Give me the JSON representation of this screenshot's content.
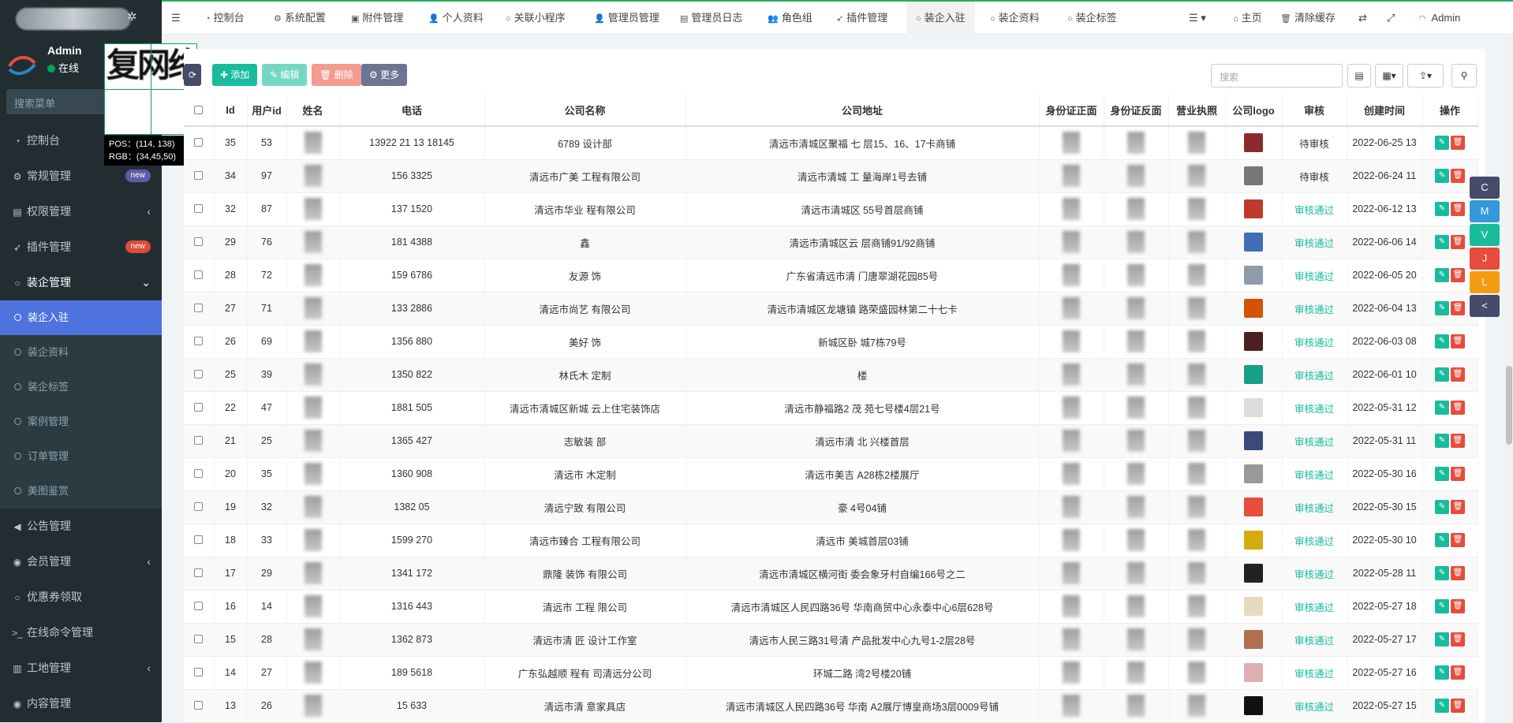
{
  "sidebar": {
    "user_name": "Admin",
    "user_status": "在线",
    "search_placeholder": "搜索菜单",
    "menu": [
      {
        "label": "控制台",
        "icon": "dashboard-icon"
      },
      {
        "label": "常规管理",
        "icon": "cogs-icon",
        "badge": "new"
      },
      {
        "label": "权限管理",
        "icon": "group-icon",
        "chevron": "‹"
      },
      {
        "label": "插件管理",
        "icon": "rocket-icon",
        "badge": "new"
      },
      {
        "label": "装企管理",
        "icon": "circle-icon",
        "chevron": "⌄"
      }
    ],
    "submenu": [
      {
        "label": "装企入驻"
      },
      {
        "label": "装企资料"
      },
      {
        "label": "装企标签"
      },
      {
        "label": "案例管理"
      },
      {
        "label": "订单管理"
      },
      {
        "label": "美图鉴赏"
      }
    ],
    "menu2": [
      {
        "label": "公告管理",
        "icon": "bullhorn-icon"
      },
      {
        "label": "会员管理",
        "icon": "user-circle-icon",
        "chevron": "‹"
      },
      {
        "label": "优惠券领取",
        "icon": "circle-icon"
      },
      {
        "label": "在线命令管理",
        "icon": "terminal-icon"
      },
      {
        "label": "工地管理",
        "icon": "bank-icon",
        "chevron": "‹"
      },
      {
        "label": "内容管理",
        "icon": "user-circle-icon"
      }
    ]
  },
  "zoom": {
    "magnified_text": "复网络",
    "pos": "POS：(114, 138)",
    "rgb": "RGB：(34,45,50)"
  },
  "topnav": {
    "tabs": [
      {
        "label": "控制台",
        "icon": "dashboard-icon"
      },
      {
        "label": "系统配置",
        "icon": "cog-icon"
      },
      {
        "label": "附件管理",
        "icon": "image-icon"
      },
      {
        "label": "个人资料",
        "icon": "user-icon"
      },
      {
        "label": "关联小程序",
        "icon": "circle-icon"
      },
      {
        "label": "管理员管理",
        "icon": "user-icon"
      },
      {
        "label": "管理员日志",
        "icon": "list-icon"
      },
      {
        "label": "角色组",
        "icon": "group-icon"
      },
      {
        "label": "插件管理",
        "icon": "rocket-icon"
      },
      {
        "label": "装企入驻",
        "icon": "circle-icon"
      },
      {
        "label": "装企资料",
        "icon": "circle-icon"
      },
      {
        "label": "装企标签",
        "icon": "circle-icon"
      }
    ],
    "home": "主页",
    "clear_cache": "清除缓存",
    "admin": "Admin"
  },
  "toolbar": {
    "add": "添加",
    "edit": "编辑",
    "delete": "删除",
    "more": "更多",
    "search_placeholder": "搜索"
  },
  "table": {
    "headers": [
      "",
      "Id",
      "用户id",
      "姓名",
      "电话",
      "公司名称",
      "公司地址",
      "身份证正面",
      "身份证反面",
      "营业执照",
      "公司logo",
      "审核",
      "创建时间",
      "操作"
    ],
    "rows": [
      {
        "id": "35",
        "uid": "53",
        "phone": "13922 21 13 18145",
        "company": "6789 设计部",
        "address": "清远市清城区聚福 七 层15、16、17卡商铺",
        "status": "待审核",
        "created": "2022-06-25 13",
        "logo_color": "#8b2b2b"
      },
      {
        "id": "34",
        "uid": "97",
        "phone": "156 3325",
        "company": "清远市广美 工程有限公司",
        "address": "清远市清城 工 量海岸1号去铺",
        "status": "待审核",
        "created": "2022-06-24 11",
        "logo_color": "#777777"
      },
      {
        "id": "32",
        "uid": "87",
        "phone": "137 1520",
        "company": "清远市华业 程有限公司",
        "address": "清远市清城区 55号首层商铺",
        "status": "审核通过",
        "created": "2022-06-12 13",
        "logo_color": "#c0392b"
      },
      {
        "id": "29",
        "uid": "76",
        "phone": "181 4388",
        "company": "鑫",
        "address": "清远市清城区云 层商铺91/92商铺",
        "status": "审核通过",
        "created": "2022-06-06 14",
        "logo_color": "#3f6fb5"
      },
      {
        "id": "28",
        "uid": "72",
        "phone": "159 6786",
        "company": "友源 饰",
        "address": "广东省清远市清 门唐翠湖花园85号",
        "status": "审核通过",
        "created": "2022-06-05 20",
        "logo_color": "#8e9bab"
      },
      {
        "id": "27",
        "uid": "71",
        "phone": "133 2886",
        "company": "清远市尚艺 有限公司",
        "address": "清远市清城区龙塘镇 路荣盛园林第二十七卡",
        "status": "审核通过",
        "created": "2022-06-04 13",
        "logo_color": "#d35400"
      },
      {
        "id": "26",
        "uid": "69",
        "phone": "1356 880",
        "company": "美好 饰",
        "address": "新城区卧 城7栋79号",
        "status": "审核通过",
        "created": "2022-06-03 08",
        "logo_color": "#4a2020"
      },
      {
        "id": "25",
        "uid": "39",
        "phone": "1350 822",
        "company": "林氏木 定制",
        "address": "楼",
        "status": "审核通过",
        "created": "2022-06-01 10",
        "logo_color": "#16a085"
      },
      {
        "id": "22",
        "uid": "47",
        "phone": "1881 505",
        "company": "清远市清城区新城 云上住宅装饰店",
        "address": "清远市静福路2 茂 苑七号楼4层21号",
        "status": "审核通过",
        "created": "2022-05-31 12",
        "logo_color": "#dddddd"
      },
      {
        "id": "21",
        "uid": "25",
        "phone": "1365 427",
        "company": "志敏装 部",
        "address": "清远市清 北 兴楼首层",
        "status": "审核通过",
        "created": "2022-05-31 11",
        "logo_color": "#3a4a7a"
      },
      {
        "id": "20",
        "uid": "35",
        "phone": "1360 908",
        "company": "清远市 木定制",
        "address": "清远市美吉 A28栋2楼展厅",
        "status": "审核通过",
        "created": "2022-05-30 16",
        "logo_color": "#999999"
      },
      {
        "id": "19",
        "uid": "32",
        "phone": "1382 05",
        "company": "清远宁致 有限公司",
        "address": "豪 4号04铺",
        "status": "审核通过",
        "created": "2022-05-30 15",
        "logo_color": "#e74c3c"
      },
      {
        "id": "18",
        "uid": "33",
        "phone": "1599 270",
        "company": "清远市臻合 工程有限公司",
        "address": "清远市 美城首层03铺",
        "status": "审核通过",
        "created": "2022-05-30 10",
        "logo_color": "#d4ac0d"
      },
      {
        "id": "17",
        "uid": "29",
        "phone": "1341 172",
        "company": "鼎隆 装饰 有限公司",
        "address": "清远市清城区横河街 委会象牙村自编166号之二",
        "status": "审核通过",
        "created": "2022-05-28 11",
        "logo_color": "#222222"
      },
      {
        "id": "16",
        "uid": "14",
        "phone": "1316 443",
        "company": "清远市 工程 限公司",
        "address": "清远市清城区人民四路36号 华南商贸中心永泰中心6层628号",
        "status": "审核通过",
        "created": "2022-05-27 18",
        "logo_color": "#e8d9c0"
      },
      {
        "id": "15",
        "uid": "28",
        "phone": "1362 873",
        "company": "清远市清 匠 设计工作室",
        "address": "清远市人民三路31号清 产品批发中心九号1-2层28号",
        "status": "审核通过",
        "created": "2022-05-27 17",
        "logo_color": "#b07050"
      },
      {
        "id": "14",
        "uid": "27",
        "phone": "189 5618",
        "company": "广东弘越顺 程有 司清远分公司",
        "address": "环城二路 湾2号楼20铺",
        "status": "审核通过",
        "created": "2022-05-27 16",
        "logo_color": "#e0b0b0"
      },
      {
        "id": "13",
        "uid": "26",
        "phone": "15 633",
        "company": "清远市清 意家具店",
        "address": "清远市清城区人民四路36号 华南 A2展厅博皇商场3层0009号铺",
        "status": "审核通过",
        "created": "2022-05-27 15",
        "logo_color": "#111111"
      }
    ]
  },
  "floating": [
    {
      "label": "C",
      "color": "#444c69"
    },
    {
      "label": "M",
      "color": "#3498db"
    },
    {
      "label": "V",
      "color": "#18bc9c"
    },
    {
      "label": "J",
      "color": "#e74c3c"
    },
    {
      "label": "L",
      "color": "#f39c12"
    },
    {
      "label": "<",
      "color": "#444c69"
    }
  ],
  "colors": {
    "sidebar": "#222d32",
    "accent": "#4e73df",
    "success": "#18bc9c",
    "danger": "#e74c3c"
  }
}
